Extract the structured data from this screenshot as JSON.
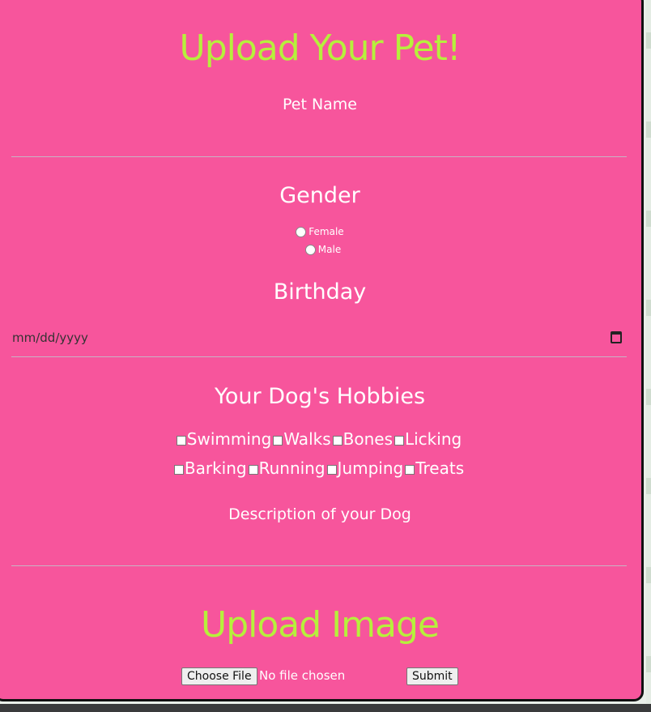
{
  "form": {
    "title": "Upload Your Pet!",
    "pet_name_label": "Pet Name",
    "gender_heading": "Gender",
    "gender_options": [
      "Female",
      "Male"
    ],
    "birthday_heading": "Birthday",
    "birthday_placeholder": "mm/dd/yyyy",
    "hobbies_heading": "Your Dog's Hobbies",
    "hobbies_row1": [
      "Swimming",
      "Walks",
      "Bones",
      "Licking"
    ],
    "hobbies_row2": [
      "Barking",
      "Running",
      "Jumping",
      "Treats"
    ],
    "description_label": "Description of your Dog",
    "upload_heading": "Upload Image",
    "choose_file_label": "Choose File",
    "no_file_text": "No file chosen",
    "submit_label": "Submit"
  },
  "colors": {
    "background": "#f7559c",
    "heading_accent": "#b6f03c",
    "text": "#ffffff"
  }
}
